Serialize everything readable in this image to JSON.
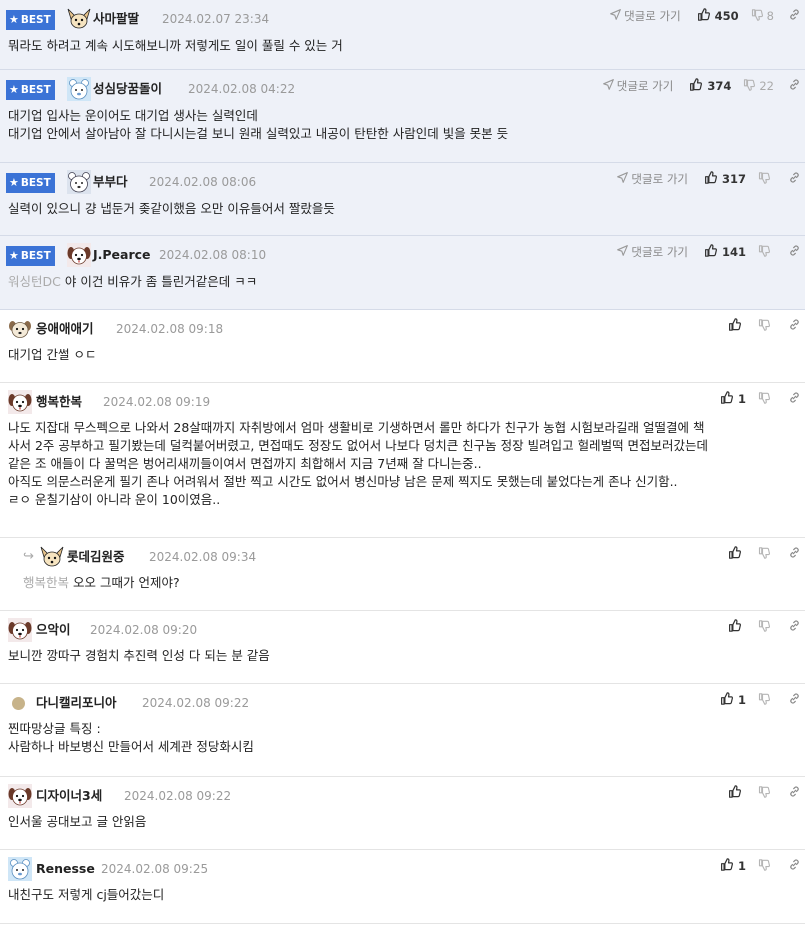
{
  "labels": {
    "best": "BEST",
    "goto": "댓글로 가기"
  },
  "colors": {
    "best_bg": "#eef1f8",
    "badge": "#3b73d6"
  },
  "comments": [
    {
      "best": true,
      "avatar": "fennec",
      "nick": "사마팔딸",
      "date": "2024.02.07 23:34",
      "likes": "450",
      "dislikes": "8",
      "prefix": "",
      "lines": [
        "뭐라도 하려고 계속 시도해보니까 저렇게도 일이 풀릴 수 있는 거"
      ]
    },
    {
      "best": true,
      "avatar": "bluebear",
      "nick": "성심당꿈돌이",
      "date": "2024.02.08 04:22",
      "likes": "374",
      "dislikes": "22",
      "prefix": "",
      "lines": [
        "대기업 입사는 운이어도 대기업 생사는 실력인데",
        "대기업 안에서 살아남아 잘 다니시는걸 보니 원래 실력있고 내공이 탄탄한 사람인데 빛을 못본 듯"
      ]
    },
    {
      "best": true,
      "avatar": "bear",
      "nick": "부부다",
      "date": "2024.02.08 08:06",
      "likes": "317",
      "dislikes": "",
      "prefix": "",
      "lines": [
        "실력이 있으니 걍 냅둔거 좆같이했음 오만 이유들어서 짤랐을듯"
      ]
    },
    {
      "best": true,
      "avatar": "dog",
      "nick": "J.Pearce",
      "date": "2024.02.08 08:10",
      "likes": "141",
      "dislikes": "",
      "prefix": "워싱턴DC",
      "lines": [
        "야 이건 비유가 좀 틀린거같은데 ㅋㅋ"
      ]
    },
    {
      "best": false,
      "avatar": "puppy",
      "nick": "응애애애기",
      "date": "2024.02.08 09:18",
      "likes": "",
      "dislikes": "",
      "prefix": "",
      "lines": [
        "대기업 간썰 ㅇㄷ"
      ]
    },
    {
      "best": false,
      "avatar": "dog",
      "nick": "행복한복",
      "date": "2024.02.08 09:19",
      "likes": "1",
      "dislikes": "",
      "prefix": "",
      "lines": [
        "나도 지잡대 무스펙으로 나와서 28살때까지 자취방에서 엄마 생활비로 기생하면서 롤만 하다가 친구가 농협 시험보라길래 얼떨결에 책",
        "사서 2주 공부하고 필기봤는데 덜컥붙어버렸고, 면접때도 정장도 없어서 나보다 덩치큰 친구놈 정장 빌려입고 헐레벌떡 면접보러갔는데",
        "같은 조 애들이 다 꿀먹은 벙어리새끼들이여서 면접까지 최합해서 지금 7년째 잘 다니는중..",
        "아직도 의문스러운게 필기 존나 어려워서 절반 찍고 시간도 없어서 병신마냥 남은 문제 찍지도 못했는데 붙었다는게 존나 신기함..",
        "ㄹㅇ 운칠기삼이 아니라 운이 10이였음.."
      ]
    },
    {
      "best": false,
      "reply": true,
      "avatar": "fennec",
      "nick": "롯데김원중",
      "date": "2024.02.08 09:34",
      "likes": "",
      "dislikes": "",
      "prefix": "행복한복",
      "lines": [
        "오오 그때가 언제야?"
      ]
    },
    {
      "best": false,
      "avatar": "dog",
      "nick": "으악이",
      "date": "2024.02.08 09:20",
      "likes": "",
      "dislikes": "",
      "prefix": "",
      "lines": [
        "보니깐 깡따구 경험치 추진력 인성 다 되는 분 같음"
      ]
    },
    {
      "best": false,
      "avatar": "dot",
      "nick": "다니캘리포니아",
      "date": "2024.02.08 09:22",
      "likes": "1",
      "dislikes": "",
      "prefix": "",
      "lines": [
        "찐따망상글 특징 :",
        "사람하나 바보병신 만들어서 세계관 정당화시킴"
      ]
    },
    {
      "best": false,
      "avatar": "dog",
      "nick": "디자이너3세",
      "date": "2024.02.08 09:22",
      "likes": "",
      "dislikes": "",
      "prefix": "",
      "lines": [
        "인서울 공대보고 글 안읽음"
      ]
    },
    {
      "best": false,
      "avatar": "bluebear",
      "nick": "Renesse",
      "date": "2024.02.08 09:25",
      "likes": "1",
      "dislikes": "",
      "prefix": "",
      "lines": [
        "내친구도 저렇게 cj들어갔는디"
      ]
    }
  ]
}
